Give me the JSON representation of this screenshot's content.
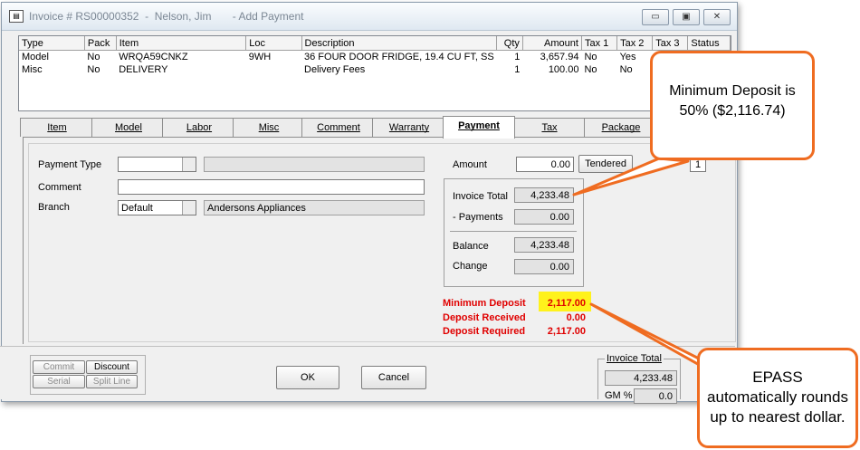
{
  "window": {
    "title": "Invoice # RS00000352  -  Nelson, Jim       - Add Payment",
    "controls": [
      "minimize",
      "restore",
      "close"
    ]
  },
  "grid": {
    "columns": [
      "Type",
      "Pack",
      "Item",
      "Loc",
      "Description",
      "Qty",
      "Amount",
      "Tax 1",
      "Tax 2",
      "Tax 3",
      "Status"
    ],
    "rows": [
      [
        "Model",
        "No",
        "WRQA59CNKZ",
        "9WH",
        "36 FOUR DOOR FRIDGE, 19.4 CU FT, SS",
        "1",
        "3,657.94",
        "No",
        "Yes",
        "",
        ""
      ],
      [
        "Misc",
        "No",
        "DELIVERY",
        "",
        "Delivery Fees",
        "1",
        "100.00",
        "No",
        "No",
        "",
        ""
      ]
    ]
  },
  "tabs": [
    "Item",
    "Model",
    "Labor",
    "Misc",
    "Comment",
    "Warranty",
    "Payment",
    "Tax",
    "Package"
  ],
  "active_tab": "Payment",
  "payment": {
    "payment_type_label": "Payment Type",
    "payment_type_value": "",
    "comment_label": "Comment",
    "comment_value": "",
    "branch_label": "Branch",
    "branch_value": "Default",
    "branch_name": "Andersons Appliances",
    "amount_label": "Amount",
    "amount_value": "0.00",
    "tendered_label": "Tendered",
    "page_num": "1"
  },
  "totals": {
    "invoice_total_label": "Invoice Total",
    "invoice_total": "4,233.48",
    "payments_label": "- Payments",
    "payments": "0.00",
    "balance_label": "Balance",
    "balance": "4,233.48",
    "change_label": "Change",
    "change": "0.00"
  },
  "deposit": {
    "minimum_label": "Minimum Deposit",
    "minimum": "2,117.00",
    "received_label": "Deposit Received",
    "received": "0.00",
    "required_label": "Deposit Required",
    "required": "2,117.00"
  },
  "footer": {
    "commit": "Commit",
    "discount": "Discount",
    "serial": "Serial",
    "split_line": "Split Line",
    "ok": "OK",
    "cancel": "Cancel",
    "invoice_total_label": "Invoice Total",
    "invoice_total": "4,233.48",
    "gm_label": "GM %",
    "gm_value": "0.0"
  },
  "callouts": {
    "top": "Minimum Deposit is 50% ($2,116.74)",
    "bottom": "EPASS automatically rounds up to nearest dollar."
  },
  "colors": {
    "accent": "#ef6c21",
    "deposit_text": "#e00000",
    "highlight": "#fff21c"
  }
}
